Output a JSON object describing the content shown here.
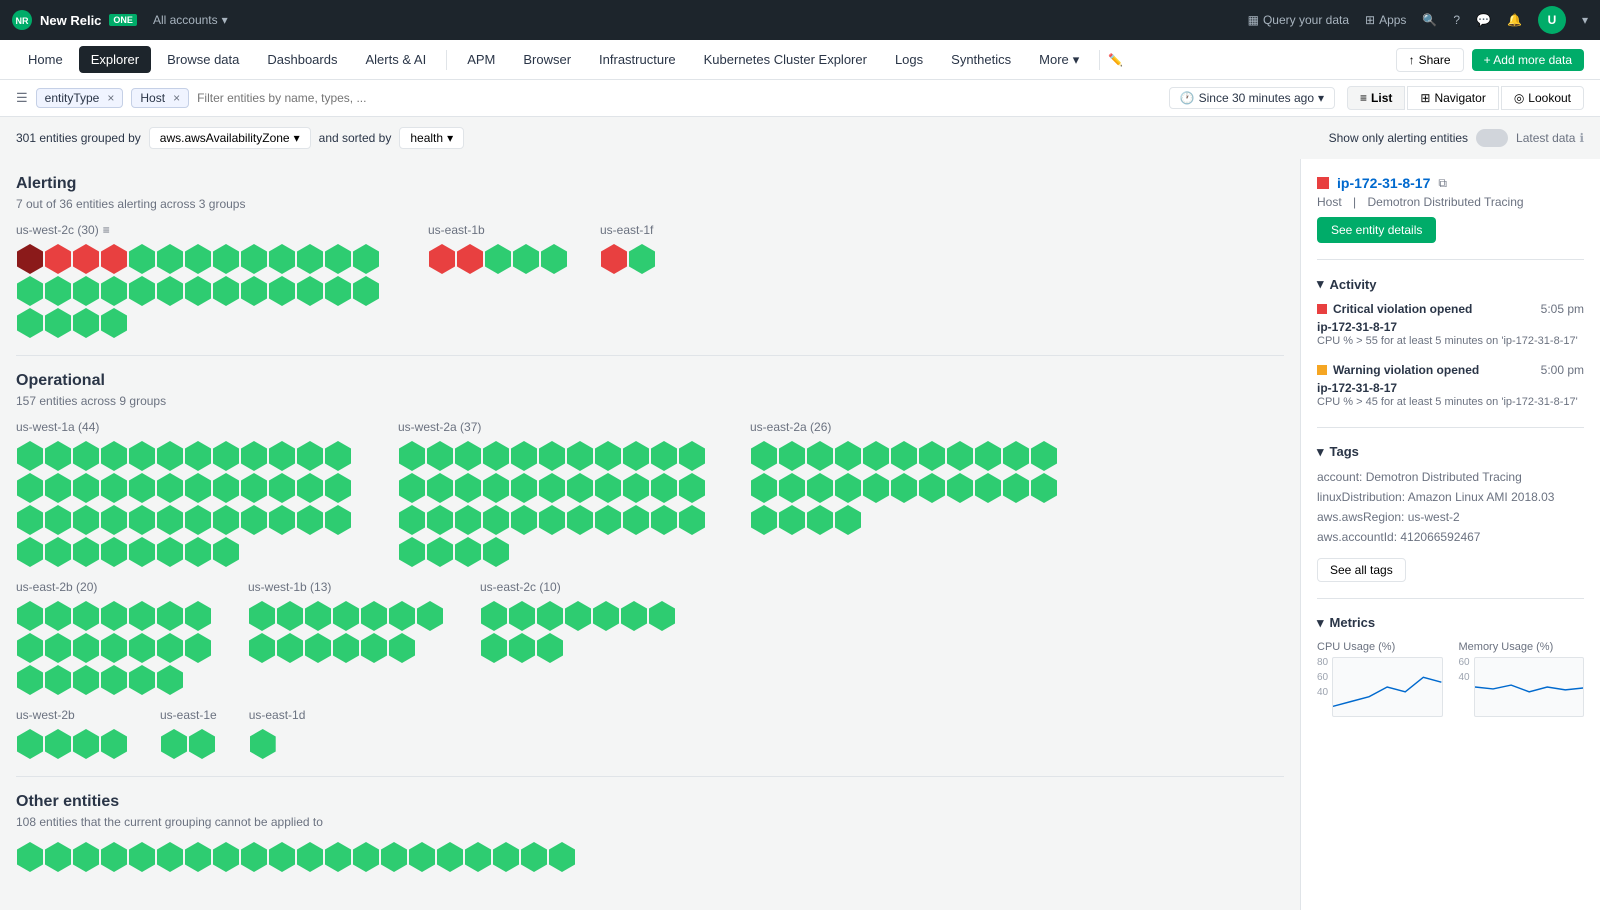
{
  "app": {
    "logo": "New Relic",
    "badge": "ONE",
    "accounts_label": "All accounts",
    "nav_items": [
      "Home",
      "Explorer",
      "Browse data",
      "Dashboards",
      "Alerts & AI",
      "APM",
      "Browser",
      "Infrastructure",
      "Kubernetes Cluster Explorer",
      "Logs",
      "Synthetics",
      "More"
    ],
    "share_label": "Share",
    "add_data_label": "+ Add more data",
    "query_data_label": "Query your data",
    "apps_label": "Apps"
  },
  "filter_bar": {
    "tags": [
      {
        "key": "entityType",
        "value": ""
      },
      {
        "key": "Host",
        "value": ""
      }
    ],
    "placeholder": "Filter entities by name, types, ...",
    "time_selector": "Since 30 minutes ago",
    "views": [
      "List",
      "Navigator",
      "Lookout"
    ]
  },
  "controls": {
    "entities_count": "301 entities grouped by",
    "group_by": "aws.awsAvailabilityZone",
    "sorted_by_label": "and sorted by",
    "sort_by": "health",
    "alert_toggle_label": "Show only alerting entities",
    "latest_data_label": "Latest data"
  },
  "sections": {
    "alerting": {
      "title": "Alerting",
      "subtitle": "7 out of 36 entities alerting across 3 groups",
      "groups": [
        {
          "name": "us-west-2c",
          "count": 30,
          "has_filter": true,
          "red_count": 4,
          "green_count": 26,
          "has_selected": true
        },
        {
          "name": "us-east-1b",
          "count": null,
          "red_count": 2,
          "green_count": 3
        },
        {
          "name": "us-east-1f",
          "count": null,
          "red_count": 1,
          "green_count": 1
        }
      ]
    },
    "operational": {
      "title": "Operational",
      "subtitle": "157 entities across 9 groups",
      "groups": [
        {
          "name": "us-west-1a",
          "count": 44,
          "green_count": 44
        },
        {
          "name": "us-west-2a",
          "count": 37,
          "green_count": 37
        },
        {
          "name": "us-east-2a",
          "count": 26,
          "green_count": 26
        },
        {
          "name": "us-east-2b",
          "count": 20,
          "green_count": 20
        },
        {
          "name": "us-west-1b",
          "count": 13,
          "green_count": 13
        },
        {
          "name": "us-east-2c",
          "count": 10,
          "green_count": 10
        },
        {
          "name": "us-west-2b",
          "count": null,
          "green_count": 4
        },
        {
          "name": "us-east-1e",
          "count": null,
          "green_count": 2
        },
        {
          "name": "us-east-1d",
          "count": null,
          "green_count": 1
        }
      ]
    },
    "other": {
      "title": "Other entities",
      "subtitle": "108 entities that the current grouping cannot be applied to"
    }
  },
  "right_panel": {
    "entity_name": "ip-172-31-8-17",
    "entity_type": "Host",
    "entity_service": "Demotron Distributed Tracing",
    "see_details_label": "See entity details",
    "activity": {
      "title": "Activity",
      "items": [
        {
          "type": "critical",
          "title": "Critical violation opened",
          "time": "5:05 pm",
          "entity": "ip-172-31-8-17",
          "desc": "CPU % > 55 for at least 5 minutes on 'ip-172-31-8-17'"
        },
        {
          "type": "warning",
          "title": "Warning violation opened",
          "time": "5:00 pm",
          "entity": "ip-172-31-8-17",
          "desc": "CPU % > 45 for at least 5 minutes on 'ip-172-31-8-17'"
        }
      ]
    },
    "tags": {
      "title": "Tags",
      "items": [
        "account: Demotron Distributed Tracing",
        "linuxDistribution: Amazon Linux AMI 2018.03",
        "aws.awsRegion: us-west-2",
        "aws.accountId: 412066592467"
      ],
      "see_all_label": "See all tags"
    },
    "metrics": {
      "title": "Metrics",
      "cpu_label": "CPU Usage (%)",
      "memory_label": "Memory Usage (%)",
      "cpu_values": [
        "80",
        "60",
        "40"
      ],
      "memory_values": [
        "60",
        "40"
      ]
    }
  }
}
